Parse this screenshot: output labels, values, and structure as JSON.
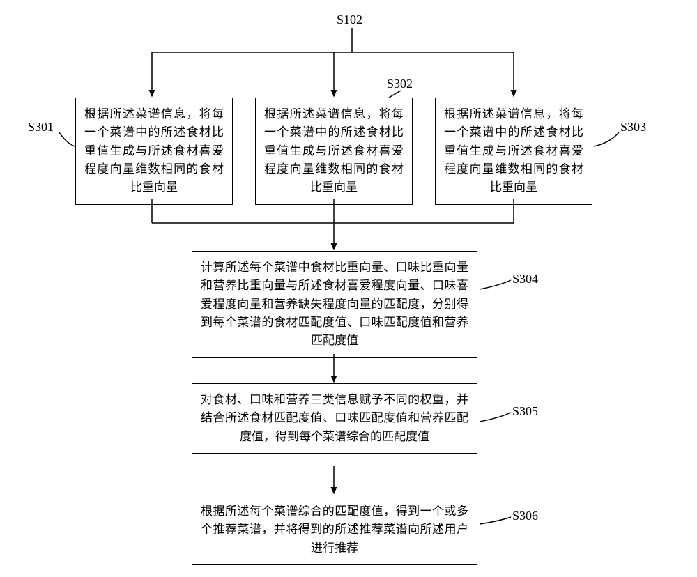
{
  "labels": {
    "top": "S102",
    "box1": "S301",
    "box2": "S302",
    "box3": "S303",
    "box4": "S304",
    "box5": "S305",
    "box6": "S306"
  },
  "boxes": {
    "b1": "根据所述菜谱信息，将每一个菜谱中的所述食材比重值生成与所述食材喜爱程度向量维数相同的食材比重向量",
    "b2": "根据所述菜谱信息，将每一个菜谱中的所述食材比重值生成与所述食材喜爱程度向量维数相同的食材比重向量",
    "b3": "根据所述菜谱信息，将每一个菜谱中的所述食材比重值生成与所述食材喜爱程度向量维数相同的食材比重向量",
    "b4": "计算所述每个菜谱中食材比重向量、口味比重向量和营养比重向量与所述食材喜爱程度向量、口味喜爱程度向量和营养缺失程度向量的匹配度，分别得到每个菜谱的食材匹配度值、口味匹配度值和营养匹配度值",
    "b5": "对食材、口味和营养三类信息赋予不同的权重，并结合所述食材匹配度值、口味匹配度值和营养匹配度值，得到每个菜谱综合的匹配度值",
    "b6": "根据所述每个菜谱综合的匹配度值，得到一个或多个推荐菜谱，并将得到的所述推荐菜谱向所述用户进行推荐"
  }
}
